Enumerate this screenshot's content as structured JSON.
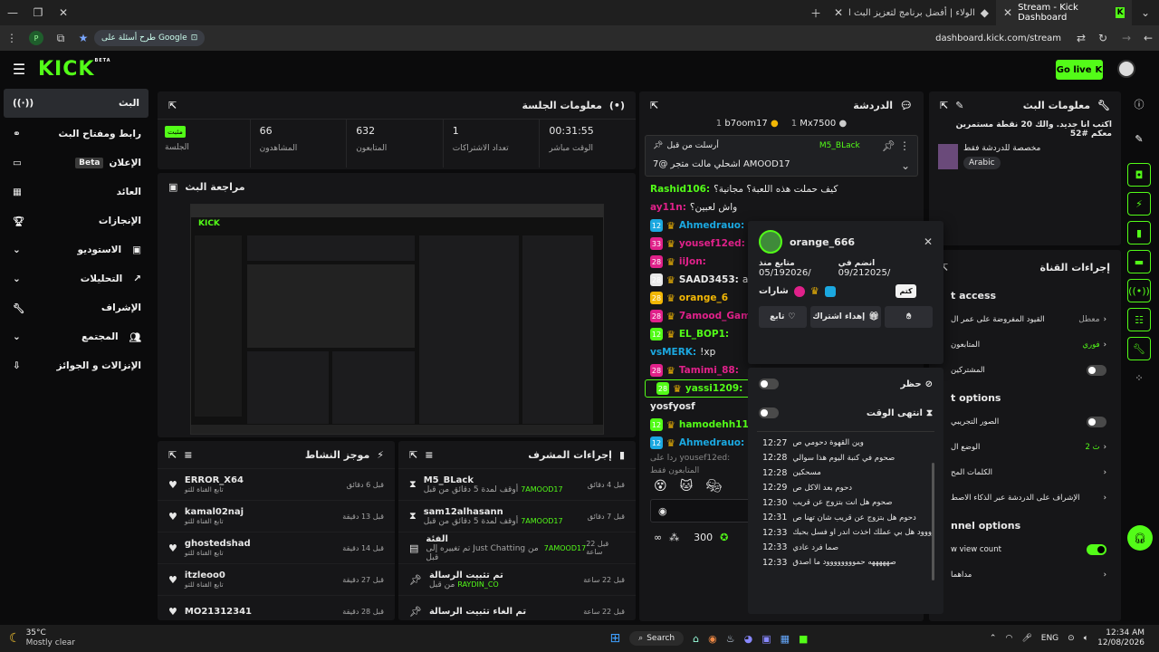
{
  "browser": {
    "tabs": [
      {
        "title": "الولاء | أفضل برنامج لتعزيز البث ا"
      },
      {
        "title": "Stream - Kick Dashboard"
      }
    ],
    "search_chip": "طرح أسئلة على Google",
    "url": "dashboard.kick.com/stream"
  },
  "header": {
    "logo": "KICK",
    "logo_sup": "BETA",
    "go_live": "Go live"
  },
  "sidebar": {
    "items": [
      {
        "label": "البث",
        "icon": "broadcast-icon"
      },
      {
        "label": "رابط ومفتاح البث",
        "icon": "link-icon"
      },
      {
        "label": "الإعلان",
        "badge": "Beta",
        "icon": "ad-icon"
      },
      {
        "label": "العائد",
        "icon": "revenue-icon"
      },
      {
        "label": "الإنجازات",
        "icon": "trophy-icon"
      },
      {
        "label": "الاستوديو",
        "icon": "studio-icon"
      },
      {
        "label": "التحليلات",
        "icon": "analytics-icon"
      },
      {
        "label": "الإشراف",
        "icon": "moderation-icon"
      },
      {
        "label": "المجتمع",
        "icon": "community-icon"
      },
      {
        "label": "الإنزالات و الجوائز",
        "icon": "drops-icon"
      }
    ]
  },
  "session": {
    "title": "معلومات الجلسة",
    "status_badge": "مثبت",
    "stats": [
      {
        "value": "",
        "label": "الجلسة"
      },
      {
        "value": "66",
        "label": "المشاهدون"
      },
      {
        "value": "632",
        "label": "المتابعون"
      },
      {
        "value": "1",
        "label": "تعداد الاشتراكات"
      },
      {
        "value": "00:31:55",
        "label": "الوقت مباشر"
      }
    ]
  },
  "preview": {
    "title": "مراجعة البث"
  },
  "activity": {
    "title": "موجز النشاط",
    "items": [
      {
        "name": "ERROR_X64",
        "sub": "تابع القناة للتو",
        "time": "قبل 6 دقائق"
      },
      {
        "name": "kamal02naj",
        "sub": "تابع القناة للتو",
        "time": "قبل 13 دقيقة"
      },
      {
        "name": "ghostedshad",
        "sub": "تابع القناة للتو",
        "time": "قبل 14 دقيقة"
      },
      {
        "name": "itzleoo0",
        "sub": "تابع القناة للتو",
        "time": "قبل 27 دقيقة"
      },
      {
        "name": "MO21312341",
        "sub": "",
        "time": "قبل 28 دقيقة"
      }
    ]
  },
  "modactions": {
    "title": "إجراءات المشرف",
    "items": [
      {
        "name": "M5_BLack",
        "sub": "أوقف لمدة 5 دقائق من قبل",
        "user": "7AMOOD17",
        "time": "قبل 4 دقائق"
      },
      {
        "name": "sam12alhasann",
        "sub": "أوقف لمدة 5 دقائق من قبل",
        "user": "7AMOOD17",
        "time": "قبل 7 دقائق"
      },
      {
        "name": "الفئة",
        "sub": "تم تغييره إلى Just Chatting من قبل",
        "user": "7AMOOD17",
        "time": "قبل 22 ساعة"
      },
      {
        "name": "تم تثبيت الرسالة",
        "sub": "من قبل",
        "user": "RAYDIN_CO",
        "time": "قبل 22 ساعة"
      },
      {
        "name": "تم الغاء تثبيت الرسالة",
        "sub": "",
        "user": "",
        "time": "قبل 22 ساعة"
      }
    ]
  },
  "chat": {
    "title": "الدردشة",
    "top_users": [
      {
        "name": "b7oom17",
        "count": "1"
      },
      {
        "name": "Mx7500",
        "count": "1"
      }
    ],
    "pinned_by": "أرسلت من قبل",
    "pinned_user": "M5_BLack",
    "pinned_msg": "7@ اشحلي مالت متجر AMOOD17",
    "lines": [
      {
        "user": "Rashid106:",
        "msg": "كيف حملت هذه اللعبة؟ مجانية؟",
        "color": "#53fc18"
      },
      {
        "user": "ay11n:",
        "msg": "واش لعبين؟",
        "color": "#e0218a"
      },
      {
        "user": "Ahmedrauo:",
        "msg": "",
        "color": "#1ba8e0",
        "num": "12"
      },
      {
        "user": "yousef12ed:",
        "msg": "ب؟",
        "color": "#e0218a",
        "num": "33"
      },
      {
        "user": "iiJon:",
        "msg": "",
        "color": "#e0218a",
        "num": "28"
      },
      {
        "user": "SAAD3453:",
        "msg": "ach",
        "color": "#e8e8e8",
        "num": "28"
      },
      {
        "user": "orange_6",
        "msg": "",
        "color": "#f2b705",
        "num": "28"
      },
      {
        "user": "7amood_Gamin",
        "msg": "",
        "color": "#e0218a",
        "num": "28"
      },
      {
        "user": "EL_BOP1:",
        "msg": "",
        "color": "#53fc18",
        "num": "12"
      },
      {
        "user": "vsMERK:",
        "msg": "!xp",
        "color": "#1ba8e0"
      },
      {
        "user": "Tamimi_88:",
        "msg": "",
        "color": "#e0218a",
        "num": "28"
      },
      {
        "user": "yassi1209:",
        "msg": "",
        "color": "#53fc18",
        "num": "28"
      },
      {
        "user": "yosfyosf",
        "msg": "",
        "color": "#e8e8e8"
      },
      {
        "user": "hamodehh11",
        "msg": "",
        "color": "#53fc18",
        "num": "12"
      },
      {
        "user": "Ahmedrauo:",
        "msg": "",
        "color": "#1ba8e0",
        "num": "12"
      }
    ],
    "reply_to": "ردا على yousef12ed:",
    "followers_only": "المتابعون فقط",
    "points": "300"
  },
  "usercard": {
    "username": "orange_666",
    "follower_since_label": "متابع منذ",
    "follower_since": "05/192026/",
    "joined_label": "انضم في",
    "joined": "09/212025/",
    "badges_label": "شارات",
    "btn_follow": "تابع",
    "btn_gift": "إهداء اشتراك",
    "btn_mute": "كتم",
    "tooltip": "كتم",
    "ban_label": "حظر",
    "timeout_label": "انتهى الوقت",
    "history": [
      {
        "time": "12:27",
        "msg": "وين القهوة دحومي ص"
      },
      {
        "time": "12:28",
        "msg": "صحوم في كنبة اليوم هذا سوالي"
      },
      {
        "time": "12:28",
        "msg": "مسحكين"
      },
      {
        "time": "12:29",
        "msg": "دحوم بعد الاكل ص"
      },
      {
        "time": "12:30",
        "msg": "صحوم هل انت بتزوج عن قريب"
      },
      {
        "time": "12:31",
        "msg": "دحوم هل بتزوج عن قريب شان تهنا ص"
      },
      {
        "time": "12:33",
        "msg": "صحوووووووود هل بي عملك اخذت اندر او فسل بحبك"
      },
      {
        "time": "12:33",
        "msg": "صما فرد عادي"
      },
      {
        "time": "12:33",
        "msg": "صهههههه حموووووووود ما اصدق"
      }
    ]
  },
  "streaminfo": {
    "title": "معلومات البث",
    "headline": "اكتب انا جديد. والك 20 نقطة مستمرين معكم #52",
    "sub": "مخصصة للدردشة فقط",
    "lang": "Arabic"
  },
  "channelactions": {
    "title": "إجراءات القناة",
    "sections": [
      {
        "heading": "t access",
        "rows": [
          {
            "label": "القيود المفروضة على عمر ال",
            "value": "معطل"
          },
          {
            "label": "المتابعون",
            "value": "فوري"
          },
          {
            "label": "المشتركين",
            "toggle": false
          }
        ]
      },
      {
        "heading": "t options",
        "rows": [
          {
            "label": "الصور التجريبي",
            "toggle": false
          },
          {
            "label": "الوضع ال",
            "value": "2 ث"
          },
          {
            "label": "الكلمات المح",
            "value": ""
          },
          {
            "label": "الإشراف على الدردشة عبر الذكاء الاصط",
            "value": ""
          }
        ]
      },
      {
        "heading": "nnel options",
        "rows": [
          {
            "label": "w view count",
            "toggle": true
          },
          {
            "label": "مداهما",
            "value": ""
          }
        ]
      }
    ]
  },
  "taskbar": {
    "temp": "35°C",
    "weather": "Mostly clear",
    "search": "Search",
    "lang": "ENG",
    "time": "12:34 AM",
    "date": "12/08/2026"
  }
}
